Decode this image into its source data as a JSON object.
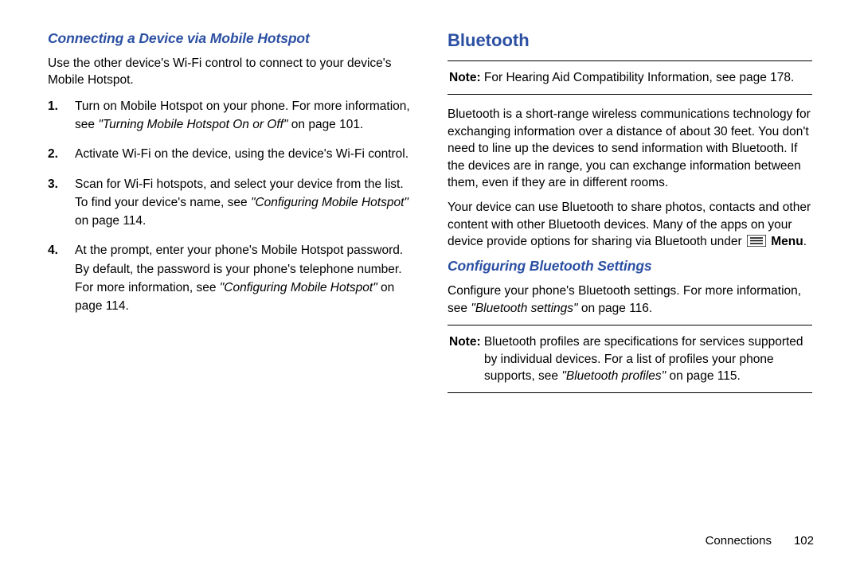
{
  "left": {
    "heading": "Connecting a Device via Mobile Hotspot",
    "intro": "Use the other device's Wi-Fi control to connect to your device's Mobile Hotspot.",
    "steps": [
      {
        "number": "1.",
        "pre": "Turn on Mobile Hotspot on your phone. For more information, see ",
        "ref": "\"Turning Mobile Hotspot On or Off\"",
        "post": " on page 101."
      },
      {
        "number": "2.",
        "pre": "Activate Wi-Fi on the device, using the device's Wi-Fi control.",
        "ref": "",
        "post": ""
      },
      {
        "number": "3.",
        "pre": "Scan for Wi-Fi hotspots, and select your device from the list. To find your device's name, see ",
        "ref": "\"Configuring Mobile Hotspot\"",
        "post": " on page 114."
      },
      {
        "number": "4.",
        "pre": "At the prompt, enter your phone's Mobile Hotspot password. By default, the password is your phone's telephone number. For more information, see ",
        "ref": "\"Configuring Mobile Hotspot\"",
        "post": " on page 114."
      }
    ]
  },
  "right": {
    "heading": "Bluetooth",
    "note1_label": "Note:",
    "note1_text": " For Hearing Aid Compatibility Information, see page 178.",
    "para1": "Bluetooth is a short-range wireless communications technology for exchanging information over a distance of about 30 feet. You don't need to line up the devices to send information with Bluetooth. If the devices are in range, you can exchange information between them, even if they are in different rooms.",
    "para2_pre": "Your device can use Bluetooth to share photos, contacts and other content with other Bluetooth devices. Many of the apps on your device provide options for sharing via Bluetooth under ",
    "para2_menu": "Menu",
    "para2_post": ".",
    "sub_heading": "Configuring Bluetooth Settings",
    "para3_pre": "Configure your phone's Bluetooth settings. For more information, see ",
    "para3_ref": "\"Bluetooth settings\"",
    "para3_post": " on page 116.",
    "note2_label": "Note:",
    "note2_pre": " Bluetooth profiles are specifications for services supported by individual devices. For a list of profiles your phone supports, see ",
    "note2_ref": "\"Bluetooth profiles\"",
    "note2_post": " on page 115."
  },
  "footer": {
    "section": "Connections",
    "page": "102"
  }
}
